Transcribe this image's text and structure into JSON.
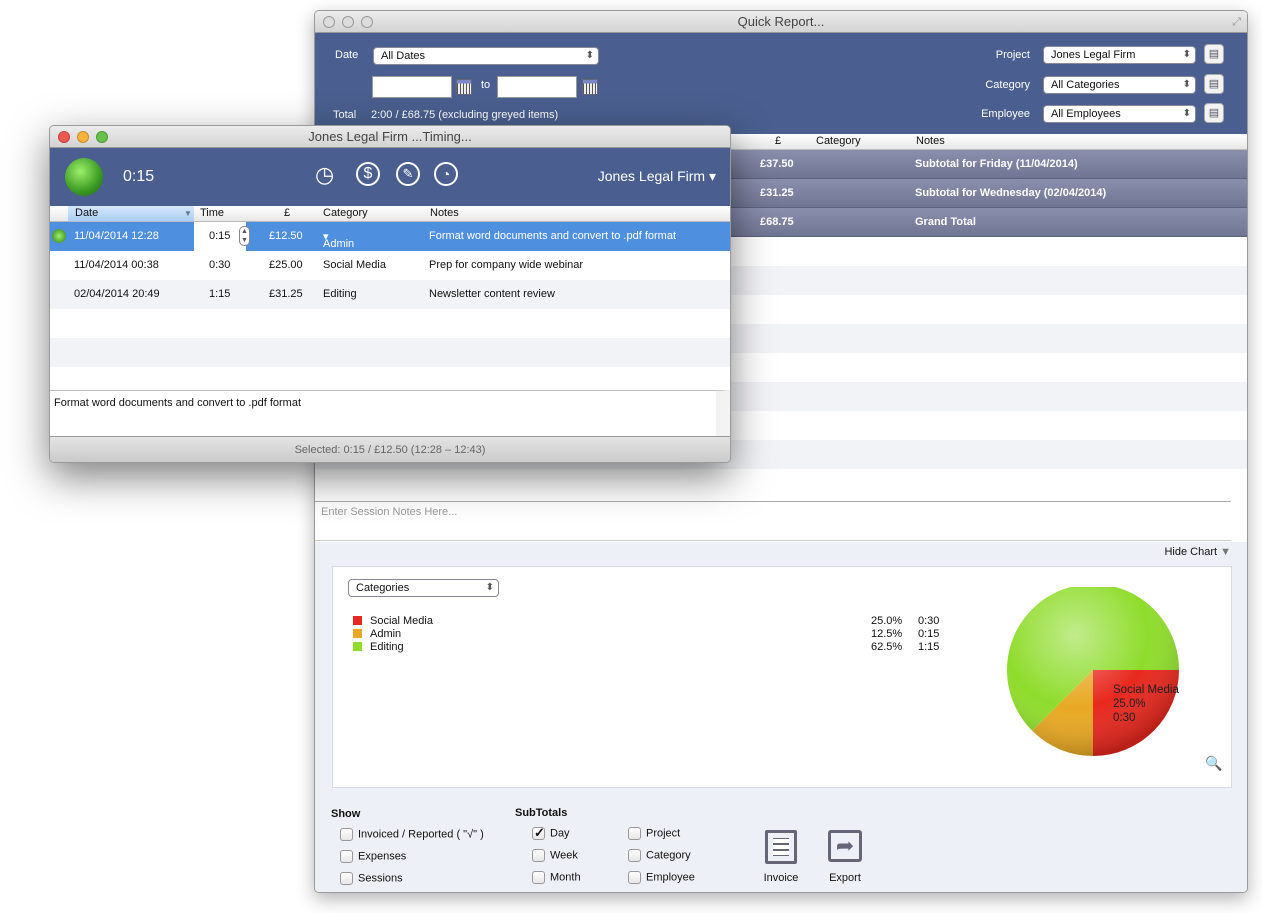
{
  "report": {
    "title": "Quick Report...",
    "date_label": "Date",
    "date_value": "All Dates",
    "to_label": "to",
    "total_label": "Total",
    "total_value": "2:00 / £68.75 (excluding greyed items)",
    "project_label": "Project",
    "project_value": "Jones Legal Firm",
    "category_label": "Category",
    "category_value": "All Categories",
    "employee_label": "Employee",
    "employee_value": "All Employees",
    "columns": {
      "amount": "£",
      "category": "Category",
      "notes": "Notes"
    },
    "rows": [
      {
        "amount": "£37.50",
        "notes": "Subtotal for Friday (11/04/2014)"
      },
      {
        "amount": "£31.25",
        "notes": "Subtotal for Wednesday (02/04/2014)"
      },
      {
        "amount": "£68.75",
        "notes": "Grand Total"
      }
    ],
    "session_notes_placeholder": "Enter Session Notes Here...",
    "hide_chart": "Hide Chart",
    "chart_select": "Categories",
    "legend": [
      {
        "name": "Social Media",
        "pct": "25.0%",
        "time": "0:30",
        "color": "#e8281e"
      },
      {
        "name": "Admin",
        "pct": "12.5%",
        "time": "0:15",
        "color": "#e8a823"
      },
      {
        "name": "Editing",
        "pct": "62.5%",
        "time": "1:15",
        "color": "#8fdc2c"
      }
    ],
    "pie_label": {
      "name": "Social Media",
      "pct": "25.0%",
      "time": "0:30"
    },
    "show_label": "Show",
    "show_options": [
      "Invoiced / Reported ( \"√\" )",
      "Expenses",
      "Sessions"
    ],
    "subtotals_label": "SubTotals",
    "subtotal_options": [
      {
        "label": "Day",
        "checked": true
      },
      {
        "label": "Week",
        "checked": false
      },
      {
        "label": "Month",
        "checked": false
      },
      {
        "label": "Project",
        "checked": false
      },
      {
        "label": "Category",
        "checked": false
      },
      {
        "label": "Employee",
        "checked": false
      }
    ],
    "invoice_label": "Invoice",
    "export_label": "Export"
  },
  "timing": {
    "title": "Jones Legal Firm ...Timing...",
    "elapsed": "0:15",
    "project": "Jones Legal Firm",
    "columns": {
      "date": "Date",
      "time": "Time",
      "amount": "£",
      "category": "Category",
      "notes": "Notes"
    },
    "rows": [
      {
        "date": "11/04/2014  12:28",
        "time": "0:15",
        "amount": "£12.50",
        "category": "Admin",
        "notes": "Format word documents and convert to .pdf format"
      },
      {
        "date": "11/04/2014  00:38",
        "time": "0:30",
        "amount": "£25.00",
        "category": "Social Media",
        "notes": "Prep for company wide webinar"
      },
      {
        "date": "02/04/2014  20:49",
        "time": "1:15",
        "amount": "£31.25",
        "category": "Editing",
        "notes": "Newsletter content review"
      }
    ],
    "note_text": "Format word documents and convert to .pdf format",
    "status": "Selected: 0:15 / £12.50 (12:28 – 12:43)"
  }
}
